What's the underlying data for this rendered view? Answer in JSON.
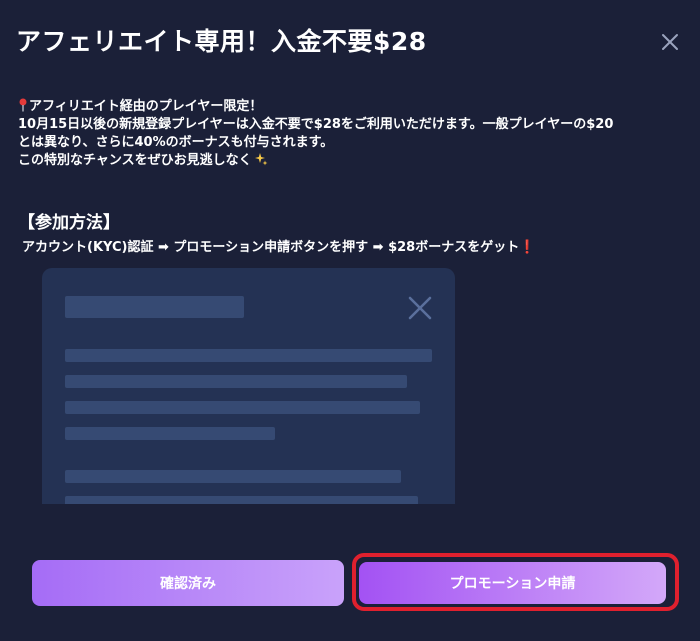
{
  "dialog": {
    "title": "アフェリエイト専用！入金不要$28",
    "close_icon": "close-icon"
  },
  "description": {
    "line1": "アフィリエイト経由のプレイヤー限定！",
    "line2": "10月15日以後の新規登録プレイヤーは入金不要で$28をご利用いただけます。一般プレイヤーの$20",
    "line3": "とは異なり、さらに40%のボーナスも付与されます。",
    "line4": "この特別なチャンスをぜひお見逃しなく",
    "pin_icon": "pin-icon",
    "sparkle_icon": "sparkles-icon"
  },
  "how_to": {
    "title": "【参加方法】",
    "steps_text": "アカウント(KYC)認証 ➡ プロモーション申請ボタンを押す ➡ $28ボーナスをゲット❗"
  },
  "illustration": {
    "icon": "dialog-mockup-illustration"
  },
  "buttons": {
    "confirm_label": "確認済み",
    "promo_label": "プロモーション申請"
  },
  "colors": {
    "background": "#1b2038",
    "highlight_border": "#e0202e",
    "button_gradient_start": "#a56cf6",
    "button_gradient_end": "#c9a2fa"
  }
}
